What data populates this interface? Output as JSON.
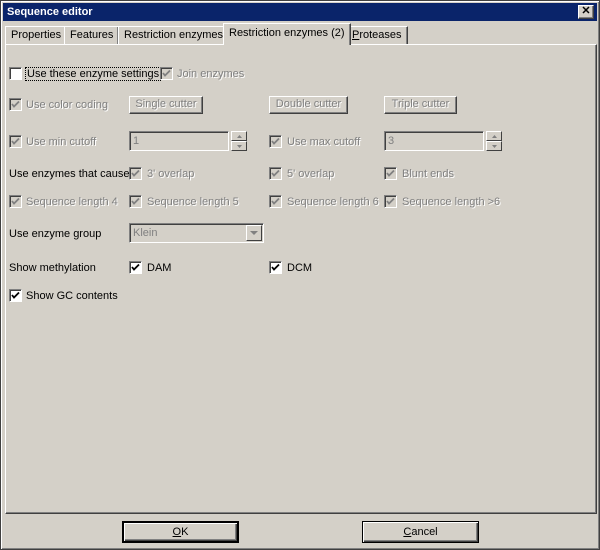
{
  "window": {
    "title": "Sequence editor",
    "close_glyph": "✕"
  },
  "tabs": [
    {
      "label": "Properties"
    },
    {
      "label": "Features"
    },
    {
      "label": "Restriction enzymes"
    },
    {
      "label": "Restriction enzymes (2)",
      "active": true
    },
    {
      "label_first": "P",
      "label_rest": "roteases"
    }
  ],
  "options": {
    "use_settings": {
      "label": "Use these enzyme settings",
      "checked": false
    },
    "join_enzymes": {
      "label": "Join enzymes",
      "checked": true,
      "disabled": true
    },
    "color_coding": {
      "label": "Use color coding",
      "checked": true,
      "disabled": true
    },
    "single_cutter": "Single cutter",
    "double_cutter": "Double cutter",
    "triple_cutter": "Triple cutter",
    "min_cutoff": {
      "label": "Use min cutoff",
      "checked": true,
      "disabled": true,
      "value": "1"
    },
    "max_cutoff": {
      "label": "Use max cutoff",
      "checked": true,
      "disabled": true,
      "value": "3"
    },
    "cause_label": "Use enzymes that cause",
    "overlap3": {
      "label": "3' overlap",
      "checked": true,
      "disabled": true
    },
    "overlap5": {
      "label": "5' overlap",
      "checked": true,
      "disabled": true
    },
    "blunt": {
      "label": "Blunt ends",
      "checked": true,
      "disabled": true
    },
    "seq4": {
      "label": "Sequence length 4",
      "checked": true,
      "disabled": true
    },
    "seq5": {
      "label": "Sequence length 5",
      "checked": true,
      "disabled": true
    },
    "seq6": {
      "label": "Sequence length 6",
      "checked": true,
      "disabled": true
    },
    "seq6plus": {
      "label": "Sequence length >6",
      "checked": true,
      "disabled": true
    },
    "group_label": "Use enzyme group",
    "group_value": "Klein",
    "methylation_label": "Show methylation",
    "dam": {
      "label": "DAM",
      "checked": true
    },
    "dcm": {
      "label": "DCM",
      "checked": true
    },
    "gc": {
      "label": "Show GC contents",
      "checked": true
    }
  },
  "buttons": {
    "ok": {
      "first": "O",
      "rest": "K"
    },
    "cancel": {
      "first": "C",
      "rest": "ancel"
    }
  },
  "icons": {
    "check": "check-icon",
    "close": "close-icon",
    "spin_up": "arrow-up-icon",
    "spin_down": "arrow-down-icon",
    "combo": "chevron-down-icon"
  }
}
